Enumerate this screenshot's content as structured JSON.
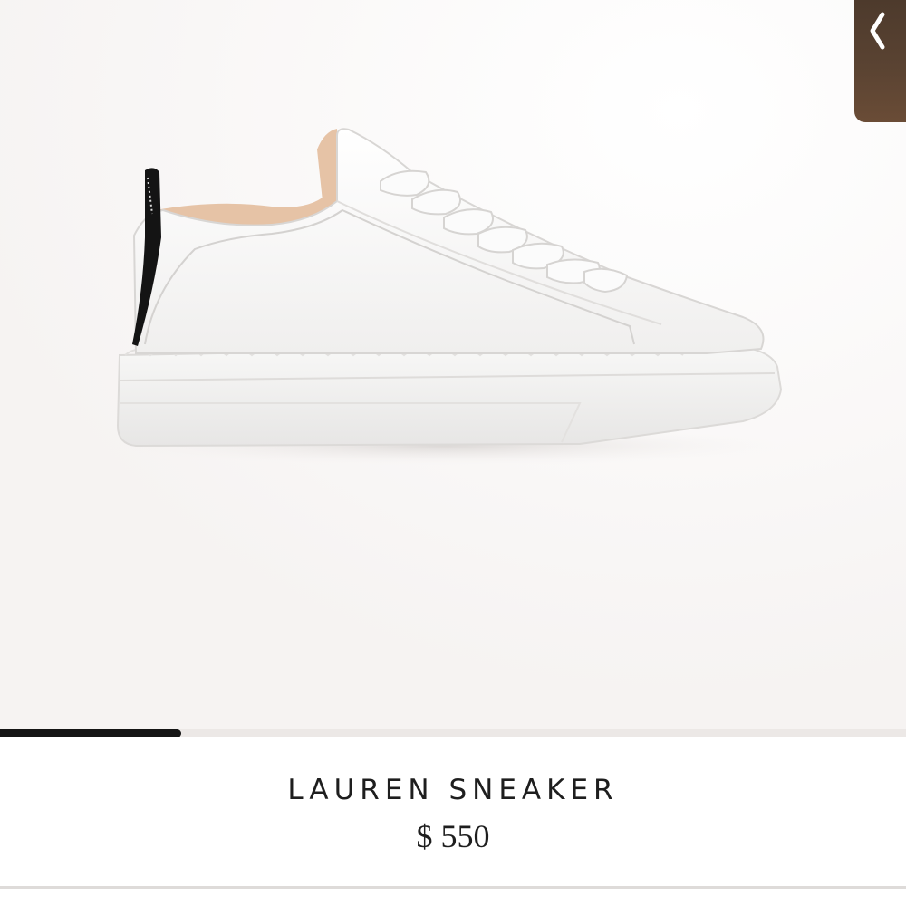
{
  "product": {
    "name": "LAUREN SNEAKER",
    "price": "$ 550"
  },
  "gallery": {
    "image_alt": "white leather sneaker, side view",
    "current_index": 1,
    "progress_fraction": 0.2,
    "prev_icon": "chevron-left-icon"
  },
  "colors": {
    "background": "#f7f4f3",
    "progress_fill": "#151515",
    "text": "#1e1e1e",
    "prev_button": "#5a4332"
  }
}
